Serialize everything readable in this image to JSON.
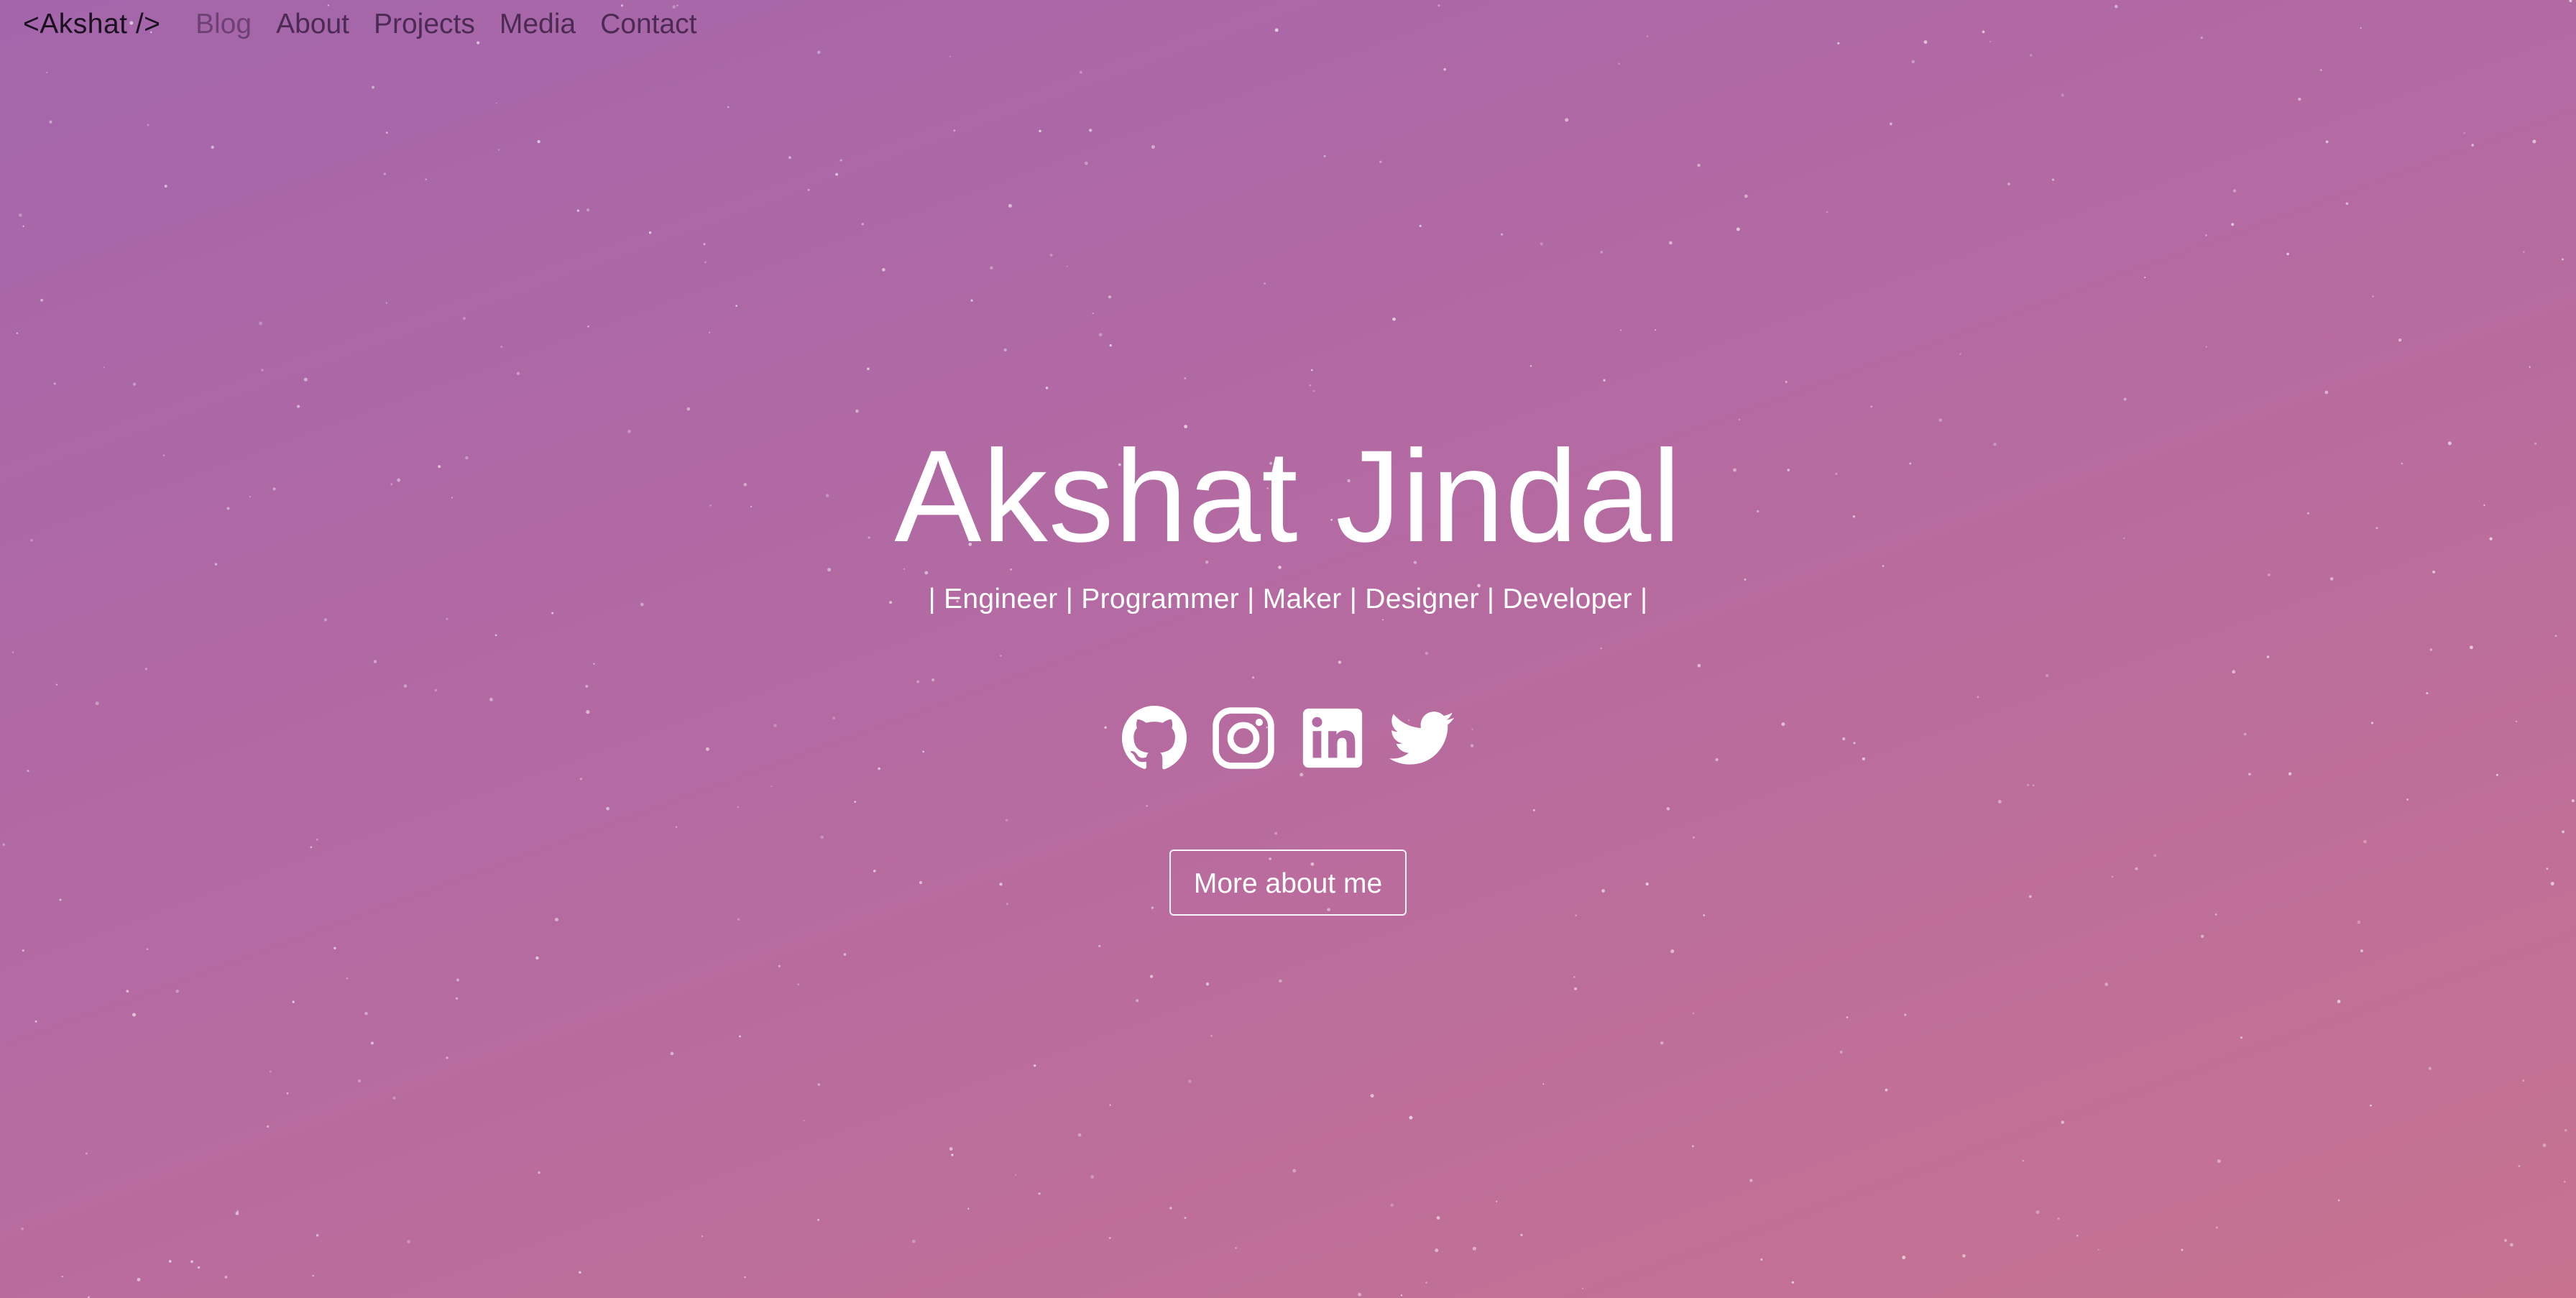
{
  "nav": {
    "brand": "<Akshat />",
    "links": [
      "Blog",
      "About",
      "Projects",
      "Media",
      "Contact"
    ]
  },
  "hero": {
    "title": "Akshat Jindal",
    "subtitle": "| Engineer | Programmer | Maker | Designer | Developer |",
    "button": "More about me"
  },
  "socials": [
    {
      "icon": "github-icon"
    },
    {
      "icon": "instagram-icon"
    },
    {
      "icon": "linkedin-icon"
    },
    {
      "icon": "twitter-icon"
    }
  ],
  "colors": {
    "gradient_start": "#a466ab",
    "gradient_end": "#c77390",
    "text": "#ffffff",
    "nav_text": "#1b1020"
  }
}
